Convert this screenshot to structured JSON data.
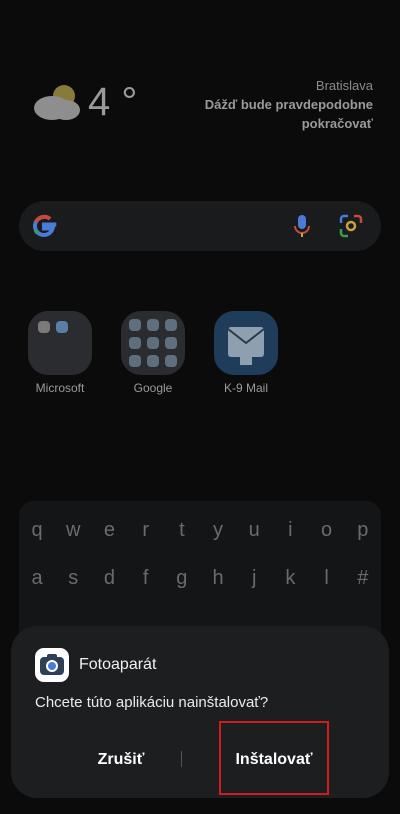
{
  "weather": {
    "temperature": "4 °",
    "city": "Bratislava",
    "forecast": "Dážď bude pravdepodobne pokračovať"
  },
  "search": {
    "icons": [
      "google-g-icon",
      "mic-icon",
      "lens-icon"
    ]
  },
  "apps": [
    {
      "label": "Microsoft"
    },
    {
      "label": "Google"
    },
    {
      "label": "K-9 Mail"
    }
  ],
  "keyboard": {
    "row1": [
      "q",
      "w",
      "e",
      "r",
      "t",
      "y",
      "u",
      "i",
      "o",
      "p"
    ],
    "row2": [
      "a",
      "s",
      "d",
      "f",
      "g",
      "h",
      "j",
      "k",
      "l",
      "#"
    ]
  },
  "dialog": {
    "app_name": "Fotoaparát",
    "question": "Chcete túto aplikáciu nainštalovať?",
    "cancel_label": "Zrušiť",
    "install_label": "Inštalovať"
  },
  "colors": {
    "highlight": "#d01c1c",
    "dialog_bg": "#1d1e20"
  }
}
